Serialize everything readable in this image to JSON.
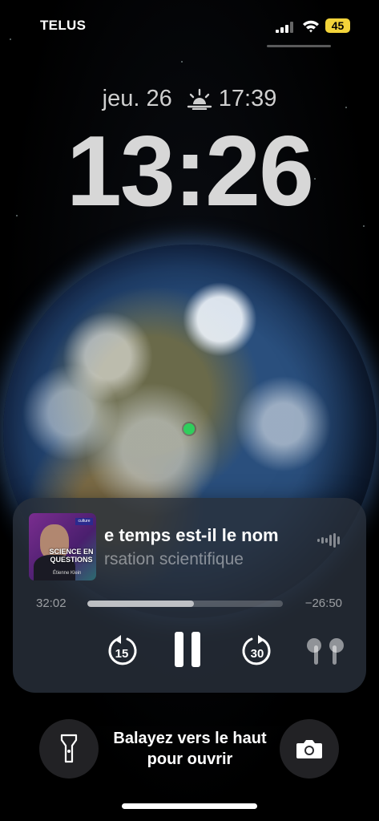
{
  "status_bar": {
    "carrier": "TELUS",
    "battery_level": "45",
    "battery_color": "#f3d43a"
  },
  "lock_screen": {
    "date": "jeu. 26",
    "sunset_icon": "sunset-icon",
    "sunset_time": "17:39",
    "clock": "13:26"
  },
  "now_playing": {
    "artwork": {
      "title": "SCIENCE EN QUESTIONS",
      "author": "Étienne Klein",
      "badge": "culture"
    },
    "title": "e temps est-il le nom",
    "subtitle": "rsation scientifique",
    "elapsed": "32:02",
    "remaining": "−26:50",
    "progress": 0.547,
    "skip_back_label": "15",
    "skip_forward_label": "30",
    "output_icon": "airpods-icon"
  },
  "bottom": {
    "unlock_hint": "Balayez vers le haut pour ouvrir",
    "left_icon": "flashlight-icon",
    "right_icon": "camera-icon"
  },
  "colors": {
    "location_dot": "#2fce5c"
  }
}
